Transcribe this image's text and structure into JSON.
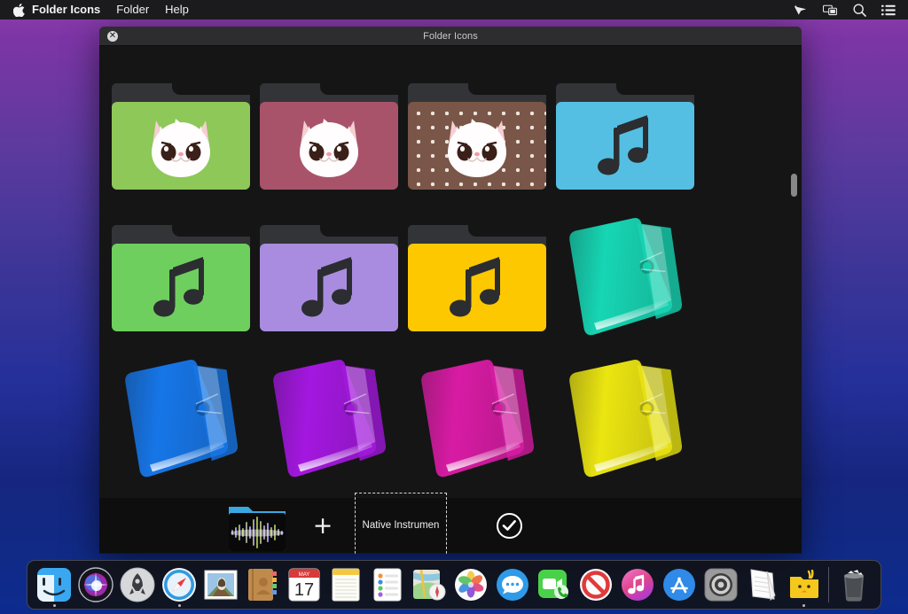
{
  "menubar": {
    "apple_icon": "apple-logo",
    "items": [
      {
        "label": "Folder Icons",
        "bold": true
      },
      {
        "label": "Folder",
        "bold": false
      },
      {
        "label": "Help",
        "bold": false
      }
    ],
    "status_icons": [
      {
        "name": "cursor-pointer-icon"
      },
      {
        "name": "screen-mirroring-icon"
      },
      {
        "name": "spotlight-search-icon"
      },
      {
        "name": "control-center-icon"
      }
    ]
  },
  "window": {
    "title": "Folder Icons",
    "close_label": "✕",
    "scrollbar_position_pct": 26
  },
  "grid": {
    "items": [
      {
        "name": "folder-cat-green",
        "style": "flat",
        "color": "#8ec858",
        "art": "cat",
        "dots": false
      },
      {
        "name": "folder-cat-rose",
        "style": "flat",
        "color": "#a9536b",
        "art": "cat",
        "dots": false
      },
      {
        "name": "folder-cat-brown-dots",
        "style": "flat",
        "color": "#7a5648",
        "art": "cat",
        "dots": true
      },
      {
        "name": "folder-music-skyblue",
        "style": "flat",
        "color": "#54bfe3",
        "art": "music",
        "dots": false
      },
      {
        "name": "folder-music-green",
        "style": "flat",
        "color": "#6ecf5e",
        "art": "music",
        "dots": false
      },
      {
        "name": "folder-music-purple",
        "style": "flat",
        "color": "#a98ce0",
        "art": "music",
        "dots": false
      },
      {
        "name": "folder-music-yellow",
        "style": "flat",
        "color": "#fdc800",
        "art": "music",
        "dots": false
      },
      {
        "name": "folder-3d-teal",
        "style": "d3",
        "color": "#16d6b4",
        "art": "none",
        "dots": false
      },
      {
        "name": "folder-3d-blue",
        "style": "d3",
        "color": "#1676e8",
        "art": "none",
        "dots": false
      },
      {
        "name": "folder-3d-purple",
        "style": "d3",
        "color": "#a417e0",
        "art": "none",
        "dots": false
      },
      {
        "name": "folder-3d-magenta",
        "style": "d3",
        "color": "#d81ba4",
        "art": "none",
        "dots": false
      },
      {
        "name": "folder-3d-yellow",
        "style": "d3",
        "color": "#ebe511",
        "art": "none",
        "dots": false
      }
    ]
  },
  "toolbar": {
    "preview_name": "folder-preview-waveform",
    "plus_label": "+",
    "dropzone_text": "Native Instrumen",
    "apply_label": "apply-checkmark"
  },
  "dock": {
    "items": [
      {
        "name": "finder",
        "running": true
      },
      {
        "name": "siri",
        "running": false
      },
      {
        "name": "launchpad",
        "running": false
      },
      {
        "name": "safari",
        "running": true
      },
      {
        "name": "mail",
        "running": false
      },
      {
        "name": "contacts",
        "running": false
      },
      {
        "name": "calendar",
        "running": false
      },
      {
        "name": "notes",
        "running": false
      },
      {
        "name": "reminders",
        "running": false
      },
      {
        "name": "maps",
        "running": false
      },
      {
        "name": "photos",
        "running": false
      },
      {
        "name": "messages",
        "running": false
      },
      {
        "name": "facetime",
        "running": false
      },
      {
        "name": "restricted-app",
        "running": false
      },
      {
        "name": "itunes",
        "running": false
      },
      {
        "name": "app-store",
        "running": false
      },
      {
        "name": "system-preferences",
        "running": false
      },
      {
        "name": "textedit",
        "running": false
      },
      {
        "name": "chick-folder",
        "running": true
      },
      {
        "name": "divider",
        "running": false
      },
      {
        "name": "trash",
        "running": false
      }
    ],
    "calendar": {
      "month": "MAY",
      "day": "17"
    }
  },
  "colors": {
    "desktop_top": "#8e3fa8",
    "desktop_bottom": "#0d2b8f",
    "window_bg": "#151515",
    "titlebar": "#2d2d30"
  }
}
